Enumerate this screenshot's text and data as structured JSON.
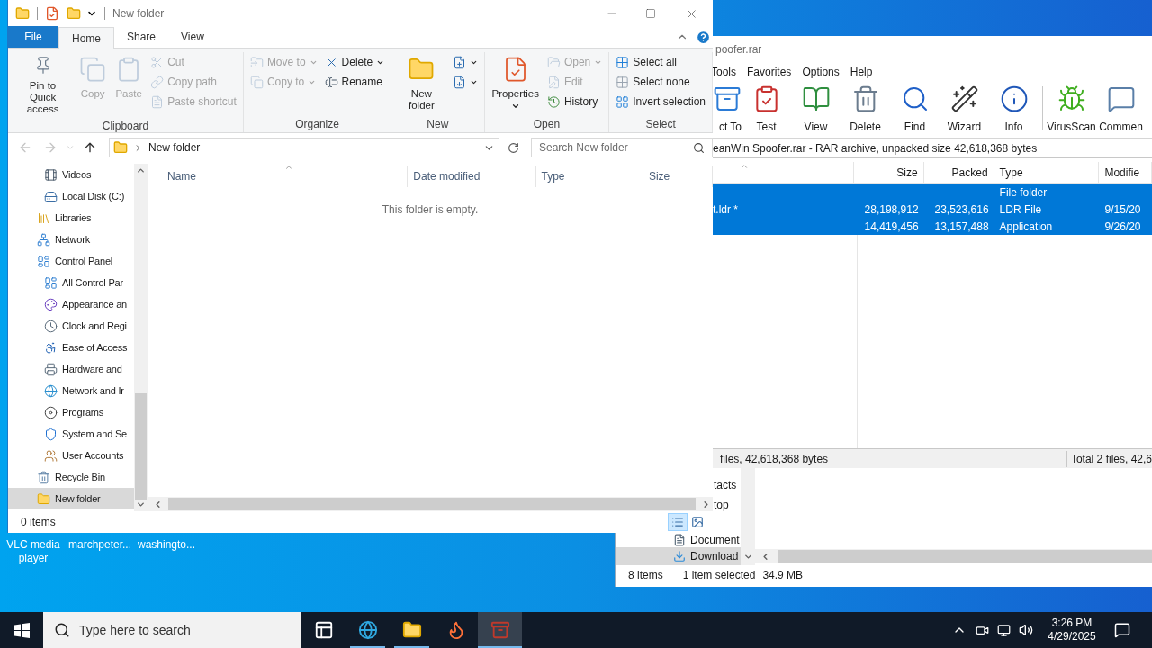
{
  "desktop_icons": [
    {
      "label": "VLC media player"
    },
    {
      "label": "marchpeter..."
    },
    {
      "label": "washingto..."
    }
  ],
  "back_explorer": {
    "nav_items": [
      {
        "kind": "partial",
        "label": "tacts",
        "selected": false
      },
      {
        "kind": "partial",
        "label": "top",
        "selected": false
      },
      {
        "kind": "document",
        "label": "Document",
        "selected": false
      },
      {
        "kind": "download",
        "label": "Download",
        "selected": true
      }
    ],
    "status": [
      "8 items",
      "1 item selected",
      "34.9 MB"
    ]
  },
  "winrar": {
    "title": "poofer.rar",
    "menu": [
      "Tools",
      "Favorites",
      "Options",
      "Help"
    ],
    "toolbar": [
      {
        "kind": "extract",
        "label": "ct To"
      },
      {
        "kind": "test",
        "label": "Test"
      },
      {
        "kind": "view",
        "label": "View"
      },
      {
        "kind": "delete",
        "label": "Delete"
      },
      {
        "kind": "find",
        "label": "Find"
      },
      {
        "kind": "wizard",
        "label": "Wizard"
      },
      {
        "kind": "info",
        "label": "Info"
      }
    ],
    "toolbar_extra": [
      {
        "kind": "virus",
        "label": "VirusScan"
      },
      {
        "kind": "comment",
        "label": "Commen"
      }
    ],
    "path": "eanWin Spoofer.rar - RAR archive, unpacked size 42,618,368 bytes",
    "columns": [
      "Size",
      "Packed",
      "Type",
      "Modifie"
    ],
    "rows": [
      {
        "type": "File folder",
        "selected": true
      },
      {
        "name": "t.ldr *",
        "size": "28,198,912",
        "packed": "23,523,616",
        "type": "LDR File",
        "modified": "9/15/20",
        "selected": true
      },
      {
        "size": "14,419,456",
        "packed": "13,157,488",
        "type": "Application",
        "modified": "9/26/20",
        "selected": true
      }
    ],
    "status_left": "files, 42,618,368 bytes",
    "status_right": "Total 2 files, 42,6"
  },
  "explorer": {
    "title": "New folder",
    "tabs": [
      {
        "kind": "backstage",
        "label": "File",
        "selected": false
      },
      {
        "kind": "tab",
        "label": "Home",
        "selected": true
      },
      {
        "kind": "tab",
        "label": "Share",
        "selected": false
      },
      {
        "kind": "tab",
        "label": "View",
        "selected": false
      }
    ],
    "groups": [
      {
        "label": "Clipboard",
        "large": [
          {
            "kind": "pin",
            "label": "Pin to Quick access",
            "disabled": false,
            "menu": false
          },
          {
            "kind": "copy",
            "label": "Copy",
            "disabled": true,
            "menu": false
          },
          {
            "kind": "paste",
            "label": "Paste",
            "disabled": true,
            "menu": false
          }
        ],
        "small": [
          [
            {
              "kind": "cut",
              "label": "Cut",
              "disabled": true,
              "menu": false
            },
            {
              "kind": "copy-path",
              "label": "Copy path",
              "disabled": true,
              "menu": false
            },
            {
              "kind": "paste-shortcut",
              "label": "Paste shortcut",
              "disabled": true,
              "menu": false
            }
          ]
        ]
      },
      {
        "label": "Organize",
        "small": [
          [
            {
              "kind": "move",
              "label": "Move to",
              "disabled": true,
              "menu": true
            },
            {
              "kind": "copy-to",
              "label": "Copy to",
              "disabled": true,
              "menu": true
            }
          ],
          [
            {
              "kind": "delete",
              "label": "Delete",
              "disabled": false,
              "menu": true
            },
            {
              "kind": "rename",
              "label": "Rename",
              "disabled": false,
              "menu": false
            }
          ]
        ]
      },
      {
        "label": "New",
        "large": [
          {
            "kind": "new-folder",
            "label": "New folder",
            "disabled": false,
            "menu": false
          }
        ],
        "small": [
          [
            {
              "kind": "new-item",
              "disabled": false,
              "menu": true
            },
            {
              "kind": "easy-access",
              "disabled": false,
              "menu": true
            }
          ]
        ]
      },
      {
        "label": "Open",
        "large": [
          {
            "kind": "properties",
            "label": "Properties",
            "disabled": false,
            "menu": true
          }
        ],
        "small": [
          [
            {
              "kind": "open",
              "label": "Open",
              "disabled": true,
              "menu": true
            },
            {
              "kind": "edit",
              "label": "Edit",
              "disabled": true,
              "menu": false
            },
            {
              "kind": "history",
              "label": "History",
              "disabled": false,
              "menu": false
            }
          ]
        ]
      },
      {
        "label": "Select",
        "small": [
          [
            {
              "kind": "select-all",
              "label": "Select all",
              "disabled": false,
              "menu": false
            },
            {
              "kind": "select-none",
              "label": "Select none",
              "disabled": false,
              "menu": false
            },
            {
              "kind": "invert",
              "label": "Invert selection",
              "disabled": false,
              "menu": false
            }
          ]
        ]
      }
    ],
    "nav_buttons": [
      {
        "kind": "back",
        "disabled": true
      },
      {
        "kind": "forward",
        "disabled": true
      },
      {
        "kind": "recent",
        "disabled": true
      },
      {
        "kind": "up",
        "disabled": false
      }
    ],
    "address": "New folder",
    "search_placeholder": "Search New folder",
    "nav": {
      "continued_children": [
        {
          "kind": "videos",
          "label": "Videos",
          "selected": false
        },
        {
          "kind": "disk",
          "label": "Local Disk (C:)",
          "selected": false
        }
      ],
      "items": [
        {
          "kind": "libraries",
          "label": "Libraries",
          "selected": false
        },
        {
          "kind": "network",
          "label": "Network",
          "selected": false
        },
        {
          "kind": "control-panel",
          "label": "Control Panel",
          "selected": false,
          "children": [
            {
              "kind": "all-items",
              "label": "All Control Par",
              "selected": false
            },
            {
              "kind": "appearance",
              "label": "Appearance an",
              "selected": false
            },
            {
              "kind": "clock",
              "label": "Clock and Regi",
              "selected": false
            },
            {
              "kind": "ease",
              "label": "Ease of Access",
              "selected": false
            },
            {
              "kind": "hardware",
              "label": "Hardware and",
              "selected": false
            },
            {
              "kind": "internet",
              "label": "Network and Ir",
              "selected": false
            },
            {
              "kind": "programs",
              "label": "Programs",
              "selected": false
            },
            {
              "kind": "system",
              "label": "System and Se",
              "selected": false
            },
            {
              "kind": "users",
              "label": "User Accounts",
              "selected": false
            }
          ]
        },
        {
          "kind": "recycle",
          "label": "Recycle Bin",
          "selected": false
        },
        {
          "kind": "folder",
          "label": "New folder",
          "selected": true
        }
      ]
    },
    "columns": [
      {
        "label": "Name",
        "sorted": true
      },
      {
        "label": "Date modified",
        "sorted": false
      },
      {
        "label": "Type",
        "sorted": false
      },
      {
        "label": "Size",
        "sorted": false
      }
    ],
    "empty_message": "This folder is empty.",
    "status": "0 items",
    "views": [
      {
        "kind": "details",
        "selected": true
      },
      {
        "kind": "large-icons",
        "selected": false
      }
    ]
  },
  "taskbar": {
    "search_placeholder": "Type here to search",
    "apps": [
      {
        "kind": "task-view",
        "running": false,
        "selected": false
      },
      {
        "kind": "edge",
        "running": true,
        "selected": false
      },
      {
        "kind": "explorer",
        "running": true,
        "selected": false
      },
      {
        "kind": "firefox",
        "running": false,
        "selected": false
      },
      {
        "kind": "winrar",
        "running": true,
        "selected": true
      }
    ],
    "time": "3:26 PM",
    "date": "4/29/2025"
  }
}
